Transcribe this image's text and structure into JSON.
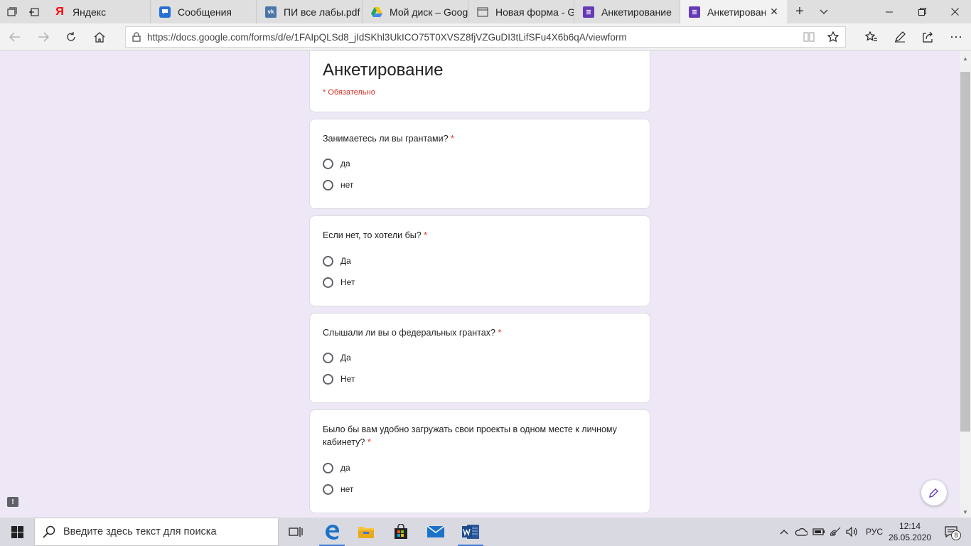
{
  "tabs": [
    {
      "label": "Яндекс",
      "favicon": "yandex-icon",
      "color": "#ff0000",
      "glyph": "Я"
    },
    {
      "label": "Сообщения",
      "favicon": "messages-icon",
      "color": "#2a6fd6",
      "glyph": ""
    },
    {
      "label": "ПИ все лабы.pdf",
      "favicon": "vk-icon",
      "color": "#4a76a8",
      "glyph": "vk"
    },
    {
      "label": "Мой диск – Googl",
      "favicon": "google-drive-icon",
      "color": "#1fa463",
      "glyph": ""
    },
    {
      "label": "Новая форма - Gc",
      "favicon": "page-icon",
      "color": "#555555",
      "glyph": ""
    },
    {
      "label": "Анкетирование",
      "favicon": "google-forms-icon",
      "color": "#673ab7",
      "glyph": ""
    },
    {
      "label": "Анкетировани",
      "favicon": "google-forms-icon",
      "color": "#673ab7",
      "glyph": "",
      "active": true
    }
  ],
  "address": {
    "url": "https://docs.google.com/forms/d/e/1FAIpQLSd8_jIdSKhl3UkICO75T0XVSZ8fjVZGuDI3tLifSFu4X6b6qA/viewform"
  },
  "form": {
    "title": "Анкетирование",
    "required_note": "* Обязательно",
    "accent": "#673ab7",
    "required_color": "#d93025",
    "questions": [
      {
        "title": "Занимаетесь ли вы грантами?",
        "star": "*",
        "options": [
          "да",
          "нет"
        ]
      },
      {
        "title": "Если нет, то хотели бы?",
        "star": "*",
        "options": [
          "Да",
          "Нет"
        ]
      },
      {
        "title": "Слышали ли вы о федеральных грантах?",
        "star": "*",
        "options": [
          "Да",
          "Нет"
        ]
      },
      {
        "title": "Было бы вам удобно загружать свои проекты в одном месте к личному кабинету?",
        "star": "*",
        "options": [
          "да",
          "нет"
        ]
      }
    ]
  },
  "taskbar": {
    "search_placeholder": "Введите здесь текст для поиска",
    "lang": "РУС",
    "time": "12:14",
    "date": "26.05.2020",
    "notifications": "8"
  }
}
